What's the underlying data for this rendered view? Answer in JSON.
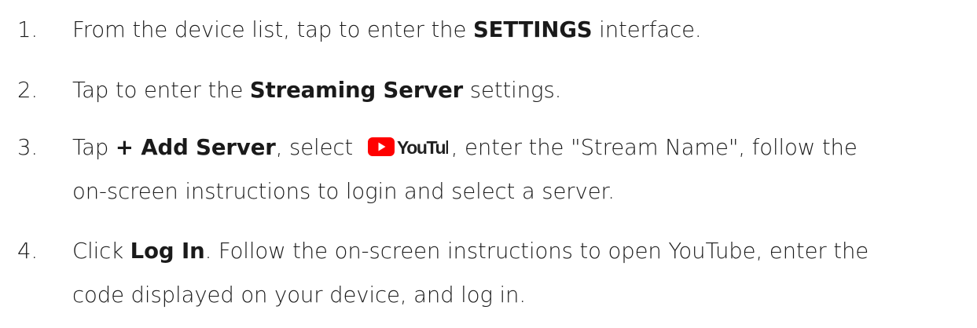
{
  "steps": [
    {
      "number": "1.",
      "parts": {
        "a": "From the device list, tap to enter the ",
        "b": "SETTINGS",
        "c": " interface."
      }
    },
    {
      "number": "2.",
      "parts": {
        "a": "Tap to enter the ",
        "b": "Streaming Server",
        "c": " settings."
      }
    },
    {
      "number": "3.",
      "parts": {
        "a": "Tap ",
        "b": "+ Add Server",
        "c": ", select ",
        "d": ", enter the \"Stream Name\", follow the",
        "e": "on-screen instructions to login and select a server."
      },
      "logo": {
        "name": "youtube-logo",
        "text": "YouTube",
        "color": "#FF0000"
      }
    },
    {
      "number": "4.",
      "parts": {
        "a": "Click ",
        "b": "Log In",
        "c": ". Follow the on-screen instructions to open YouTube, enter the",
        "d": "code displayed on your device, and log in."
      }
    }
  ]
}
